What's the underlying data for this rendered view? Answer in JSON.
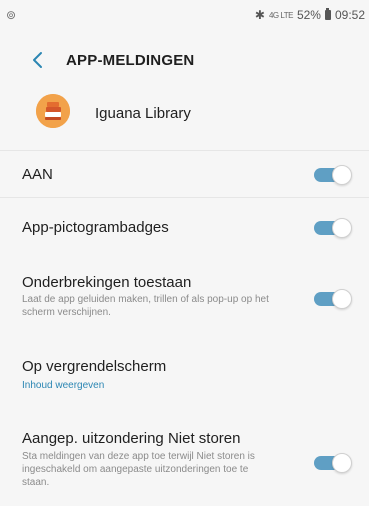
{
  "status_bar": {
    "left_icon": "camera-icon",
    "bluetooth": "✱",
    "signal": "4G LTE",
    "battery": "52%",
    "time": "09:52"
  },
  "header": {
    "back_icon": "chevron-left-icon",
    "title": "APP-MELDINGEN"
  },
  "app": {
    "icon": "books-icon",
    "name": "Iguana Library"
  },
  "settings": [
    {
      "title": "AAN",
      "enabled": true
    },
    {
      "title": "App-pictogrambadges",
      "enabled": true
    },
    {
      "title": "Onderbrekingen toestaan",
      "description": "Laat de app geluiden maken, trillen of als pop-up op het scherm verschijnen.",
      "enabled": true
    },
    {
      "title": "Op vergrendelscherm",
      "link": "Inhoud weergeven"
    },
    {
      "title": "Aangep. uitzondering Niet storen",
      "description": "Sta meldingen van deze app toe terwijl Niet storen is ingeschakeld om aangepaste uitzonderingen toe te staan.",
      "enabled": true
    }
  ],
  "colors": {
    "background": "#f6f6f6",
    "toggle_on": "#5f9fc4",
    "link": "#2b86b3",
    "description": "#8b8b8b"
  }
}
